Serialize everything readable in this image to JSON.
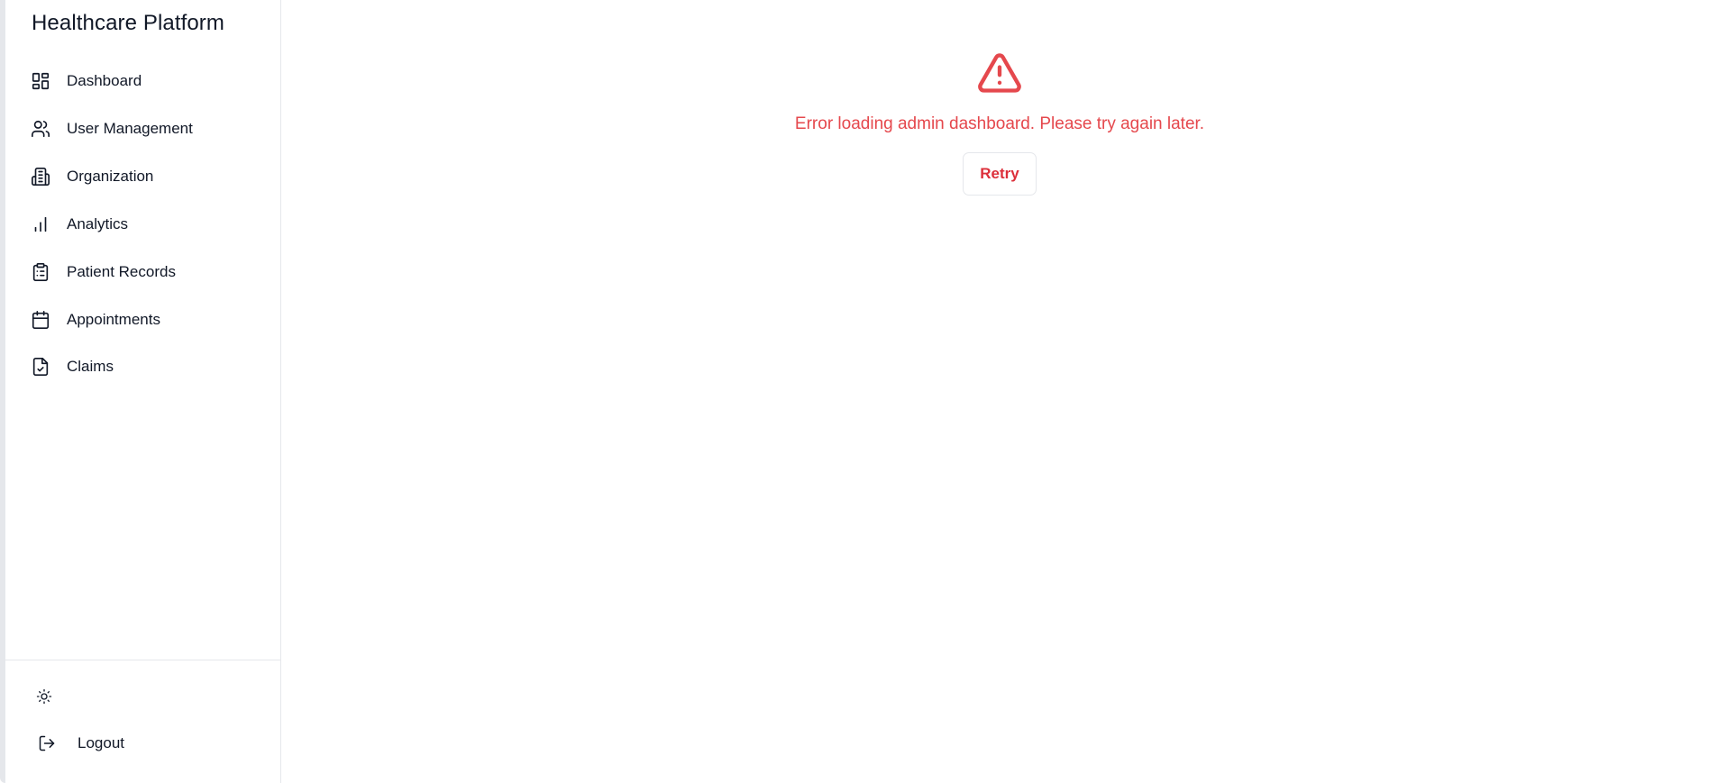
{
  "sidebar": {
    "brand": "Healthcare Platform",
    "items": [
      {
        "label": "Dashboard",
        "icon": "layout-dashboard-icon"
      },
      {
        "label": "User Management",
        "icon": "users-icon"
      },
      {
        "label": "Organization",
        "icon": "building-icon"
      },
      {
        "label": "Analytics",
        "icon": "bar-chart-icon"
      },
      {
        "label": "Patient Records",
        "icon": "clipboard-list-icon"
      },
      {
        "label": "Appointments",
        "icon": "calendar-icon"
      },
      {
        "label": "Claims",
        "icon": "file-check-icon"
      }
    ],
    "footer": {
      "theme_icon": "sun-icon",
      "logout_label": "Logout",
      "logout_icon": "log-out-icon"
    }
  },
  "main": {
    "error_icon": "alert-triangle-icon",
    "error_message": "Error loading admin dashboard. Please try again later.",
    "retry_label": "Retry"
  },
  "colors": {
    "error": "#e5484d",
    "retry_text": "#dc2f3a",
    "border": "#e5e7eb"
  }
}
